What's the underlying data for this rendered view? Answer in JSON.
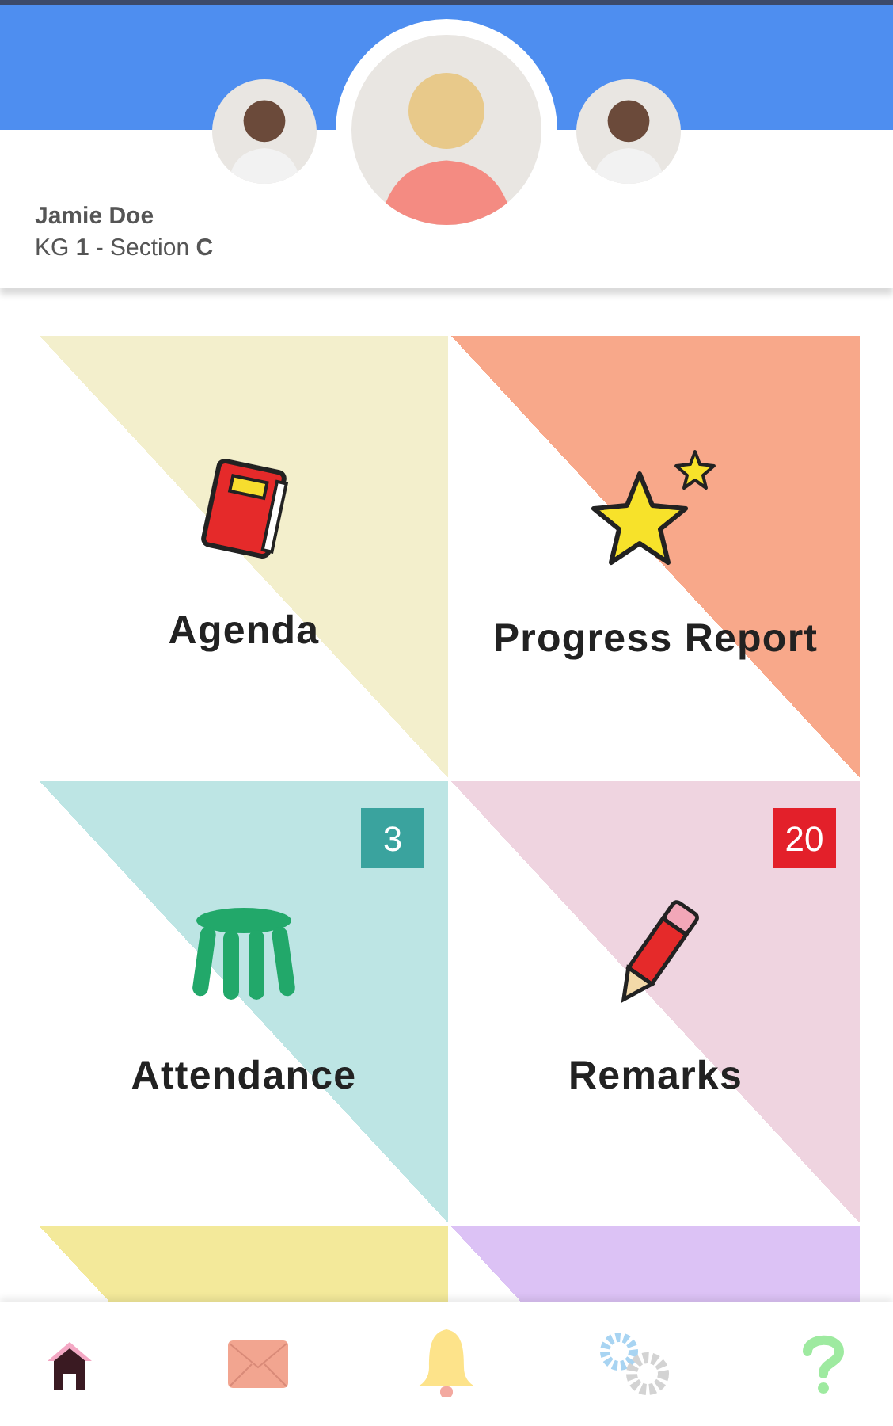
{
  "students": [
    {
      "selected": false
    },
    {
      "selected": true
    },
    {
      "selected": false
    }
  ],
  "student": {
    "name": "Jamie Doe",
    "class_line": "KG **1** - Section **C**"
  },
  "tiles": [
    {
      "kind": "book",
      "label": "Agenda",
      "color": "#f3efcc"
    },
    {
      "kind": "star",
      "label": "Progress Report",
      "color": "#f8a88a"
    },
    {
      "kind": "stool",
      "label": "Attendance",
      "color": "#bde5e4",
      "badge": {
        "text": "3",
        "color": "#3aa39e"
      }
    },
    {
      "kind": "pencil",
      "label": "Remarks",
      "color": "#efd4e0",
      "badge": {
        "text": "20",
        "color": "#e3202a"
      }
    },
    {
      "kind": "blank",
      "color": "#f3e99a"
    },
    {
      "kind": "blank",
      "color": "#dcc2f5"
    }
  ],
  "nav": [
    {
      "kind": "home",
      "selected": true
    },
    {
      "kind": "mail",
      "selected": false
    },
    {
      "kind": "bell",
      "selected": false
    },
    {
      "kind": "settings",
      "selected": false
    },
    {
      "kind": "help",
      "selected": false
    }
  ]
}
